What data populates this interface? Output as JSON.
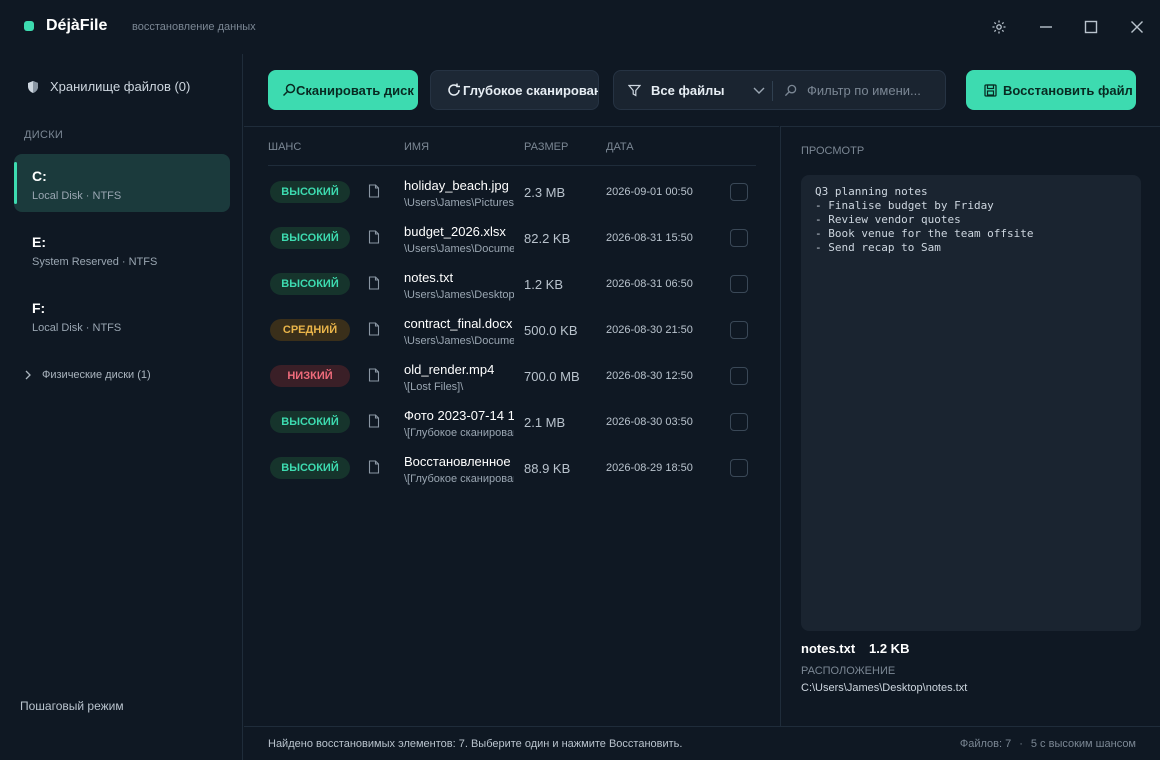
{
  "app": {
    "name": "DéjàFile",
    "subtitle": "восстановление данных",
    "accent": "#3ddbb0"
  },
  "sidebar": {
    "vault_label": "Хранилище файлов (0)",
    "section_label": "ДИСКИ",
    "disks": [
      {
        "letter": "C:",
        "meta": "Local Disk · NTFS",
        "active": true
      },
      {
        "letter": "E:",
        "meta": "System Reserved · NTFS",
        "active": false
      },
      {
        "letter": "F:",
        "meta": "Local Disk · NTFS",
        "active": false
      }
    ],
    "physical_label": "Физические диски (1)",
    "step_mode_label": "Пошаговый режим"
  },
  "toolbar": {
    "scan_label": "Сканировать диск",
    "deep_scan_label": "Глубокое сканирование",
    "filter_select": "Все файлы",
    "filter_placeholder": "Фильтр по имени...",
    "restore_label": "Восстановить файл"
  },
  "table": {
    "headers": {
      "chance": "ШАНС",
      "name": "ИМЯ",
      "size": "РАЗМЕР",
      "date": "ДАТА"
    },
    "rows": [
      {
        "chance": "ВЫСОКИЙ",
        "level": "high",
        "name": "holiday_beach.jpg",
        "path": "\\Users\\James\\Pictures",
        "size": "2.3 MB",
        "date": "2026-09-01 00:50"
      },
      {
        "chance": "ВЫСОКИЙ",
        "level": "high",
        "name": "budget_2026.xlsx",
        "path": "\\Users\\James\\Documents",
        "size": "82.2 KB",
        "date": "2026-08-31 15:50"
      },
      {
        "chance": "ВЫСОКИЙ",
        "level": "high",
        "name": "notes.txt",
        "path": "\\Users\\James\\Desktop",
        "size": "1.2 KB",
        "date": "2026-08-31 06:50"
      },
      {
        "chance": "СРЕДНИЙ",
        "level": "mid",
        "name": "contract_final.docx",
        "path": "\\Users\\James\\Documents",
        "size": "500.0 KB",
        "date": "2026-08-30 21:50"
      },
      {
        "chance": "НИЗКИЙ",
        "level": "low",
        "name": "old_render.mp4",
        "path": "\\[Lost Files]\\",
        "size": "700.0 MB",
        "date": "2026-08-30 12:50"
      },
      {
        "chance": "ВЫСОКИЙ",
        "level": "high",
        "name": "Фото 2023-07-14 1",
        "path": "\\[Глубокое сканирование]",
        "size": "2.1 MB",
        "date": "2026-08-30 03:50"
      },
      {
        "chance": "ВЫСОКИЙ",
        "level": "high",
        "name": "Восстановленное",
        "path": "\\[Глубокое сканирование]",
        "size": "88.9 KB",
        "date": "2026-08-29 18:50"
      }
    ]
  },
  "preview": {
    "label": "ПРОСМОТР",
    "content": "Q3 planning notes\n- Finalise budget by Friday\n- Review vendor quotes\n- Book venue for the team offsite\n- Send recap to Sam",
    "file_name": "notes.txt",
    "file_size": "1.2 KB",
    "location_label": "РАСПОЛОЖЕНИЕ",
    "location": "C:\\Users\\James\\Desktop\\notes.txt"
  },
  "status": {
    "message": "Найдено восстановимых элементов: 7. Выберите один и нажмите Восстановить.",
    "files_count": "Файлов: 7",
    "separator": "·",
    "high_chance": "5 с высоким шансом"
  }
}
